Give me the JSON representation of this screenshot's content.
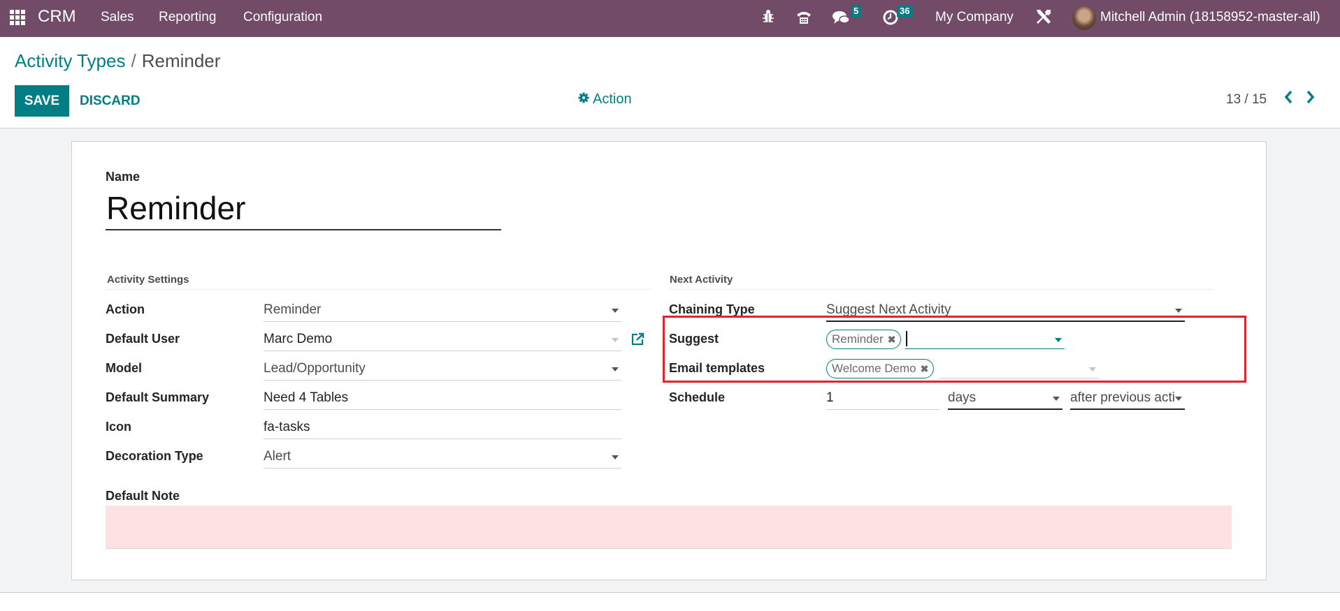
{
  "navbar": {
    "app_name": "CRM",
    "menu": [
      "Sales",
      "Reporting",
      "Configuration"
    ],
    "icons": [
      "bug-icon",
      "phone-icon",
      "chat-icon",
      "clock-icon",
      "tools-icon"
    ],
    "messages_count": "5",
    "activities_count": "36",
    "company": "My Company",
    "user": "Mitchell Admin (18158952-master-all)"
  },
  "control_panel": {
    "breadcrumb_parent": "Activity Types",
    "breadcrumb_separator": "/",
    "breadcrumb_current": "Reminder",
    "save_label": "SAVE",
    "discard_label": "DISCARD",
    "action_label": "Action",
    "pager": "13 / 15",
    "prev_icon": "‹",
    "next_icon": "›"
  },
  "form": {
    "name_label": "Name",
    "name_value": "Reminder",
    "activity_settings": {
      "title": "Activity Settings",
      "fields": [
        {
          "label": "Action",
          "value": "Reminder"
        },
        {
          "label": "Default User",
          "value": "Marc Demo"
        },
        {
          "label": "Model",
          "value": "Lead/Opportunity"
        },
        {
          "label": "Default Summary",
          "value": "Need 4 Tables"
        },
        {
          "label": "Icon",
          "value": "fa-tasks"
        },
        {
          "label": "Decoration Type",
          "value": "Alert"
        }
      ]
    },
    "next_activity": {
      "title": "Next Activity",
      "chaining_type_label": "Chaining Type",
      "chaining_type_value": "Suggest Next Activity",
      "suggest_label": "Suggest",
      "suggest_tags": [
        "Reminder"
      ],
      "email_templates_label": "Email templates",
      "email_templates_tags": [
        "Welcome Demo"
      ],
      "schedule_label": "Schedule",
      "schedule_count": "1",
      "schedule_unit": "days",
      "schedule_from": "after previous acti"
    },
    "default_note_label": "Default Note",
    "default_note_value": ""
  },
  "colors": {
    "navbar": "#714b67",
    "accent": "#017e84",
    "highlight": "#e5222b",
    "note_bg": "#fee2e3"
  }
}
